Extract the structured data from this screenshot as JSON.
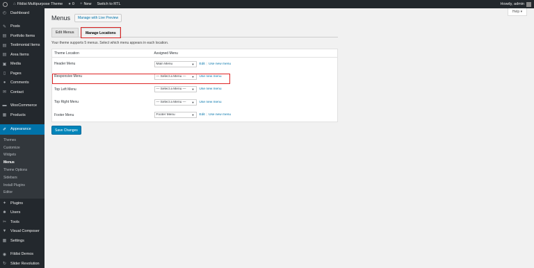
{
  "adminbar": {
    "site_name": "Fildisi Multipurpose Theme",
    "comments_count": "0",
    "new_label": "New",
    "rtl_label": "Switch to RTL",
    "howdy": "Howdy, admin"
  },
  "sidebar": {
    "items_top": [
      {
        "label": "Dashboard",
        "icon": "dashboard-icon",
        "glyph": "◴"
      }
    ],
    "items_main": [
      {
        "label": "Posts",
        "icon": "pin-icon",
        "glyph": "✎"
      },
      {
        "label": "Portfolio Items",
        "icon": "portfolio-icon",
        "glyph": "▤"
      },
      {
        "label": "Testimonial Items",
        "icon": "testimonial-icon",
        "glyph": "▤"
      },
      {
        "label": "Area Items",
        "icon": "area-icon",
        "glyph": "▤"
      },
      {
        "label": "Media",
        "icon": "media-icon",
        "glyph": "▣"
      },
      {
        "label": "Pages",
        "icon": "pages-icon",
        "glyph": "▯"
      },
      {
        "label": "Comments",
        "icon": "comments-icon",
        "glyph": "●"
      },
      {
        "label": "Contact",
        "icon": "envelope-icon",
        "glyph": "✉"
      }
    ],
    "items_shop": [
      {
        "label": "WooCommerce",
        "icon": "woocommerce-icon",
        "glyph": "▬"
      },
      {
        "label": "Products",
        "icon": "products-icon",
        "glyph": "▦"
      }
    ],
    "appearance": {
      "label": "Appearance",
      "icon": "paintbrush-icon",
      "glyph": "✐"
    },
    "submenu": [
      "Themes",
      "Customize",
      "Widgets",
      "Menus",
      "Theme Options",
      "Sidebars",
      "Install Plugins",
      "Editor"
    ],
    "current_submenu": "Menus",
    "items_bottom": [
      {
        "label": "Plugins",
        "icon": "plugins-icon",
        "glyph": "✦"
      },
      {
        "label": "Users",
        "icon": "users-icon",
        "glyph": "☻"
      },
      {
        "label": "Tools",
        "icon": "tools-icon",
        "glyph": "✂"
      },
      {
        "label": "Visual Composer",
        "icon": "visual-composer-icon",
        "glyph": "▼"
      },
      {
        "label": "Settings",
        "icon": "settings-icon",
        "glyph": "▦"
      }
    ],
    "items_extra": [
      {
        "label": "Fildisi Demos",
        "icon": "demos-icon",
        "glyph": "◉"
      },
      {
        "label": "Slider Revolution",
        "icon": "slider-icon",
        "glyph": "↻"
      }
    ]
  },
  "help_tab": "Help ▾",
  "page": {
    "title": "Menus",
    "preview_button": "Manage with Live Preview",
    "tabs": [
      "Edit Menus",
      "Manage Locations"
    ],
    "active_tab": "Manage Locations",
    "intro": "Your theme supports 5 menus. Select which menu appears in each location.",
    "columns": [
      "Theme Location",
      "Assigned Menu"
    ],
    "rows": [
      {
        "location": "Header Menu",
        "assigned": "Main Menu",
        "edit": "Edit",
        "use_new": "Use new menu"
      },
      {
        "location": "Responsive Menu",
        "assigned": "— Select a Menu —",
        "edit": "",
        "use_new": "Use new menu"
      },
      {
        "location": "Top Left Menu",
        "assigned": "— Select a Menu —",
        "edit": "",
        "use_new": "Use new menu"
      },
      {
        "location": "Top Right Menu",
        "assigned": "— Select a Menu —",
        "edit": "",
        "use_new": "Use new menu"
      },
      {
        "location": "Footer Menu",
        "assigned": "Footer Menu",
        "edit": "Edit",
        "use_new": "Use new menu"
      }
    ],
    "save_button": "Save Changes"
  },
  "colors": {
    "admin_dark": "#23282d",
    "accent_blue": "#0073aa",
    "highlight_red": "#dd2222"
  }
}
